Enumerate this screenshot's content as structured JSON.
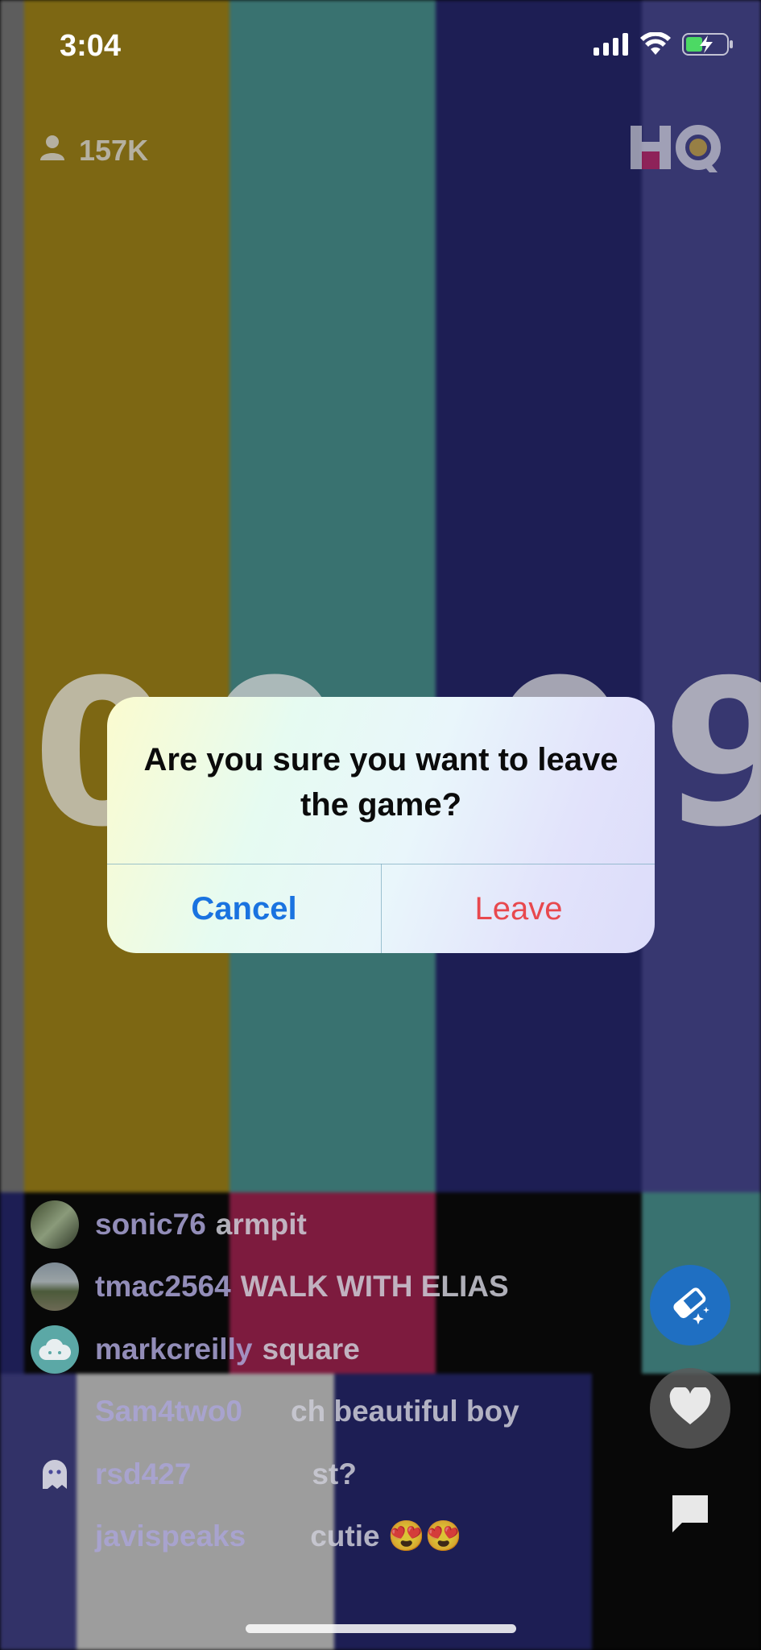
{
  "status_bar": {
    "time": "3:04",
    "icons": [
      "signal-icon",
      "wifi-icon",
      "battery-charging-icon"
    ]
  },
  "viewers": {
    "icon": "person-icon",
    "count": "157K"
  },
  "logo": {
    "text": "HQ"
  },
  "countdown": {
    "text": "00:09"
  },
  "alert": {
    "title": "Are you sure you want to leave the game?",
    "cancel_label": "Cancel",
    "leave_label": "Leave"
  },
  "chat": {
    "messages": [
      {
        "user": "sonic76",
        "text": "armpit",
        "avatar": "photo"
      },
      {
        "user": "tmac2564",
        "text": "WALK WITH ELIAS",
        "avatar": "photo"
      },
      {
        "user": "markcreilly",
        "text": "square",
        "avatar": "cloud-icon"
      },
      {
        "user": "Sam4two0",
        "text": "ch beautiful boy",
        "avatar": ""
      },
      {
        "user": "rsd427",
        "text": "st?",
        "avatar": "ghost-icon"
      },
      {
        "user": "javispeaks",
        "text": "cutie 😍😍",
        "avatar": ""
      }
    ]
  },
  "side_buttons": {
    "eraser": "eraser-icon",
    "heart": "heart-icon",
    "chat": "chat-bubble-icon"
  },
  "colors": {
    "cancel": "#1a73e0",
    "leave": "#e8484e",
    "eraser_button": "#1f6fc2"
  }
}
